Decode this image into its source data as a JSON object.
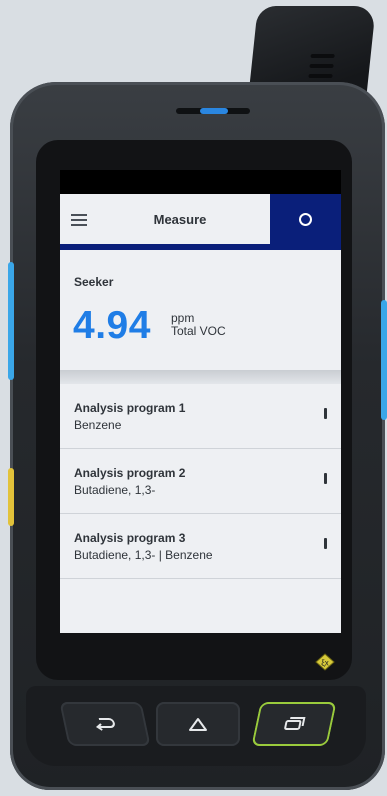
{
  "app": {
    "title": "Measure"
  },
  "seeker": {
    "label": "Seeker",
    "reading": "4.94",
    "unit": "ppm",
    "gas": "Total VOC"
  },
  "programs": [
    {
      "title": "Analysis program 1",
      "substances": "Benzene"
    },
    {
      "title": "Analysis program 2",
      "substances": "Butadiene, 1,3-"
    },
    {
      "title": "Analysis program 3",
      "substances": "Butadiene, 1,3- | Benzene"
    }
  ],
  "icons": {
    "menu": "hamburger-icon",
    "status": "circle-icon",
    "more": "vertical-kebab-icon",
    "ex": "atex-ex-icon",
    "back": "back-arrow-icon",
    "home": "home-icon",
    "recent": "recent-apps-icon"
  },
  "colors": {
    "accent": "#0a1f7a",
    "reading": "#1f7de6",
    "side_buttons": "#3aa6e8",
    "recent_highlight": "#9acb3c"
  }
}
